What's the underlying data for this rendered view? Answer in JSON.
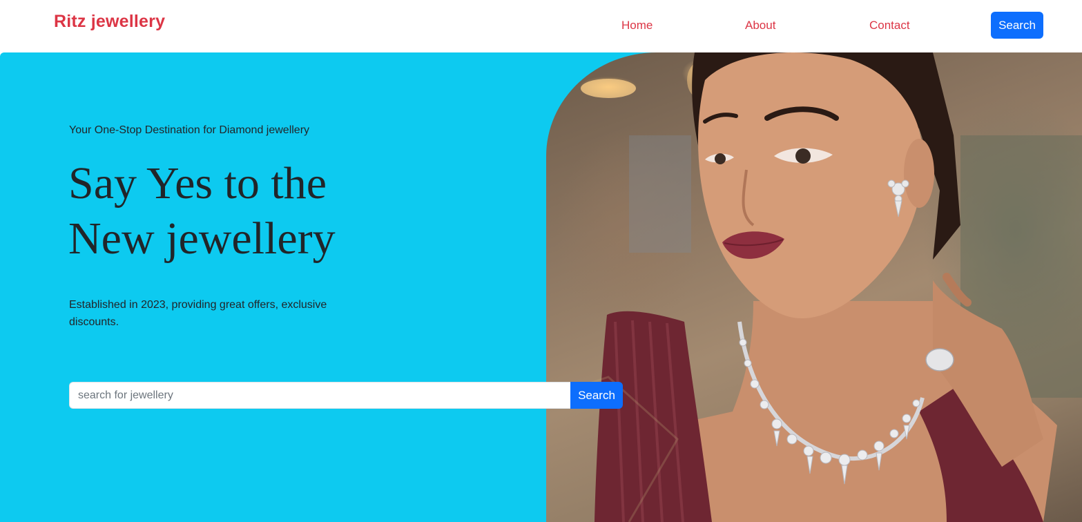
{
  "navbar": {
    "brand": "Ritz jewellery",
    "links": [
      {
        "label": "Home"
      },
      {
        "label": "About"
      },
      {
        "label": "Contact"
      }
    ],
    "search_label": "Search"
  },
  "hero": {
    "tagline": "Your One-Stop Destination for Diamond jewellery",
    "headline_line1": "Say Yes to the",
    "headline_line2": "New jewellery",
    "description": "Established in 2023, providing great offers, exclusive discounts.",
    "search": {
      "placeholder": "search for jewellery",
      "value": "",
      "button_label": "Search"
    },
    "image": {
      "alt": "woman wearing diamond necklace earrings and ring"
    }
  },
  "colors": {
    "brand": "#dc3545",
    "hero_background": "#0dcaf0",
    "primary_button": "#0d6efd",
    "text": "#212529"
  }
}
